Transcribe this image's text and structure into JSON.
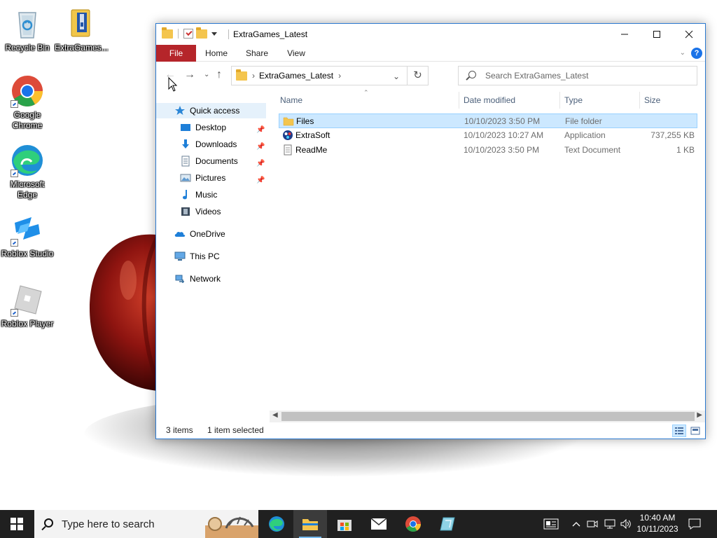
{
  "desktop": {
    "icons": [
      {
        "label": "Recycle Bin"
      },
      {
        "label": "ExtraGames..."
      },
      {
        "label": "Google Chrome"
      },
      {
        "label": "Microsoft Edge"
      },
      {
        "label": "Roblox Studio"
      },
      {
        "label": "Roblox Player"
      }
    ]
  },
  "window": {
    "title": "ExtraGames_Latest",
    "ribbon_tabs": [
      "File",
      "Home",
      "Share",
      "View"
    ],
    "address_crumb": "ExtraGames_Latest",
    "search_placeholder": "Search ExtraGames_Latest",
    "nav_items": [
      {
        "label": "Quick access",
        "icon": "star-icon"
      },
      {
        "label": "Desktop",
        "icon": "desktop-icon",
        "pinned": true
      },
      {
        "label": "Downloads",
        "icon": "download-icon",
        "pinned": true
      },
      {
        "label": "Documents",
        "icon": "document-icon",
        "pinned": true
      },
      {
        "label": "Pictures",
        "icon": "picture-icon",
        "pinned": true
      },
      {
        "label": "Music",
        "icon": "music-icon"
      },
      {
        "label": "Videos",
        "icon": "video-icon"
      },
      {
        "label": "OneDrive",
        "icon": "cloud-icon"
      },
      {
        "label": "This PC",
        "icon": "computer-icon"
      },
      {
        "label": "Network",
        "icon": "network-icon"
      }
    ],
    "columns": [
      "Name",
      "Date modified",
      "Type",
      "Size"
    ],
    "files": [
      {
        "name": "Files",
        "date": "10/10/2023 3:50 PM",
        "type": "File folder",
        "size": "",
        "icon": "folder-icon"
      },
      {
        "name": "ExtraSoft",
        "date": "10/10/2023 10:27 AM",
        "type": "Application",
        "size": "737,255 KB",
        "icon": "app-icon"
      },
      {
        "name": "ReadMe",
        "date": "10/10/2023 3:50 PM",
        "type": "Text Document",
        "size": "1 KB",
        "icon": "text-file-icon"
      }
    ],
    "status": {
      "items": "3 items",
      "selected": "1 item selected"
    }
  },
  "taskbar": {
    "search_text": "Type here to search",
    "time": "10:40 AM",
    "date": "10/11/2023"
  },
  "colors": {
    "file_tab": "#b5252a",
    "selection": "#cce8ff",
    "taskbar": "#202020"
  }
}
